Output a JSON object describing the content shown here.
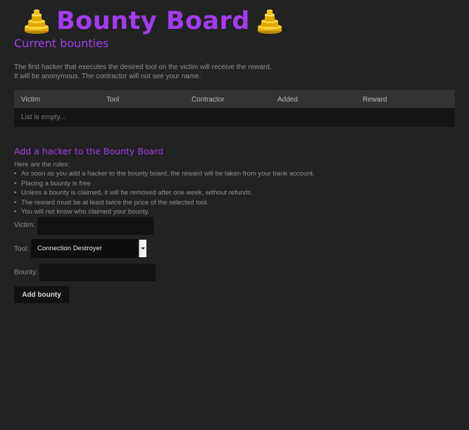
{
  "header": {
    "title": "Bounty Board",
    "subtitle": "Current bounties",
    "icon": "gold-coins-icon"
  },
  "intro": {
    "line1": "The first hacker that executes the desired tool on the victim will receive the reward.",
    "line2": "It will be anonymous. The contractor will not see your name."
  },
  "table": {
    "columns": [
      "Victim",
      "Tool",
      "Contractor",
      "Added",
      "Reward"
    ],
    "rows": [],
    "empty_text": "List is empty..."
  },
  "add_section": {
    "title": "Add a hacker to the Bounty Board",
    "rules_intro": "Here are the rules:",
    "rules": [
      "As soon as you add a hacker to the bounty board, the reward will be taken from your bank account.",
      "Placing a bounty is free .",
      "Unless a bounty is claimed, it will be removed after one week, without refunds.",
      "The reward must be at least twice the price of the selected tool.",
      "You will not know who claimed your bounty."
    ]
  },
  "form": {
    "victim_label": "Victim:",
    "victim_value": "",
    "tool_label": "Tool:",
    "tool_selected": "Connection Destroyer",
    "bounty_label": "Bounty:",
    "bounty_value": "",
    "submit_label": "Add bounty"
  },
  "colors": {
    "accent": "#a33cf0",
    "background": "#222222",
    "table_header": "#333333",
    "input_bg": "#121212",
    "coin": "#f2c21b"
  }
}
